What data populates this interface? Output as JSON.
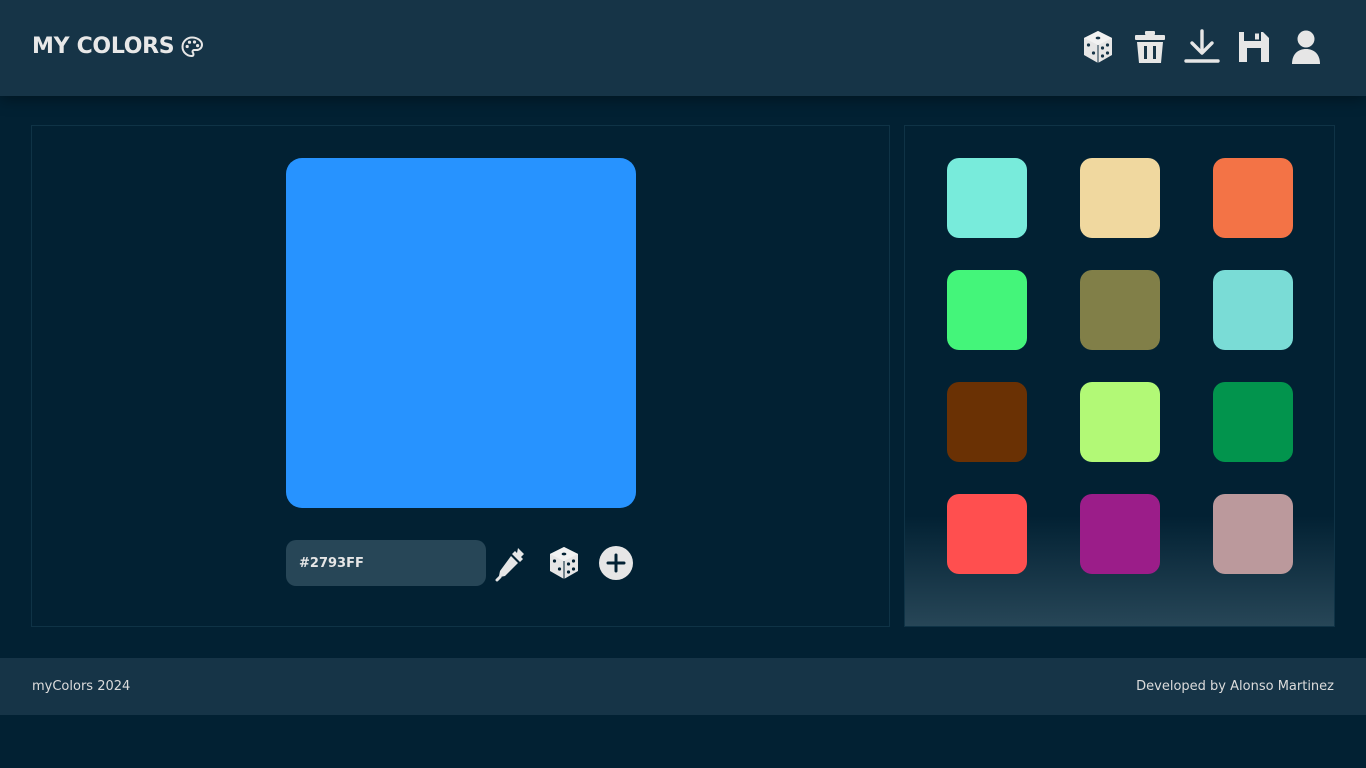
{
  "header": {
    "title": "MY COLORS",
    "title_icon": "palette-icon",
    "toolbar": [
      {
        "name": "random-dice-button",
        "icon": "dice-icon"
      },
      {
        "name": "delete-button",
        "icon": "trash-icon"
      },
      {
        "name": "download-button",
        "icon": "download-icon"
      },
      {
        "name": "save-button",
        "icon": "floppy-disk-icon"
      },
      {
        "name": "profile-button",
        "icon": "user-icon"
      }
    ]
  },
  "editor": {
    "current_color": "#2793FF",
    "hex_value": "#2793FF",
    "tools": [
      {
        "name": "eyedropper-button",
        "icon": "eyedropper-icon"
      },
      {
        "name": "random-color-button",
        "icon": "dice-icon"
      },
      {
        "name": "add-color-button",
        "icon": "plus-circle-icon"
      }
    ]
  },
  "palette": {
    "swatches": [
      "#78EBDB",
      "#F0D89F",
      "#F37346",
      "#44F57A",
      "#817F48",
      "#7ADCD6",
      "#6A3104",
      "#B2F976",
      "#02944D",
      "#FF4F4F",
      "#9B1D89",
      "#BB999C"
    ]
  },
  "footer": {
    "left_text": "myColors 2024",
    "right_text": "Developed by Alonso Martinez"
  },
  "theme": {
    "background": "#022133",
    "bar": "#163447",
    "input": "#274657",
    "icon": "#e6e6e6"
  }
}
